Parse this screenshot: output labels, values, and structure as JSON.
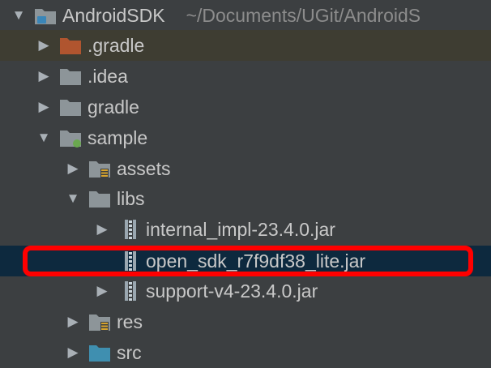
{
  "tree": {
    "root": {
      "label": "AndroidSDK",
      "path": "~/Documents/UGit/AndroidS"
    },
    "items": [
      {
        "label": ".gradle"
      },
      {
        "label": ".idea"
      },
      {
        "label": "gradle"
      },
      {
        "label": "sample"
      },
      {
        "label": "assets"
      },
      {
        "label": "libs"
      },
      {
        "label": "internal_impl-23.4.0.jar"
      },
      {
        "label": "open_sdk_r7f9df38_lite.jar"
      },
      {
        "label": "support-v4-23.4.0.jar"
      },
      {
        "label": "res"
      },
      {
        "label": "src"
      }
    ]
  },
  "colors": {
    "background": "#3c3f41",
    "folder": "#8d9599",
    "gradle_folder": "#b0552f",
    "src_folder": "#3f8fb0",
    "selection": "#0d293e",
    "highlight_border": "#ff0000"
  },
  "icons": {
    "collapsed": "chevron-right-icon",
    "expanded": "chevron-down-icon",
    "module": "module-folder-icon",
    "folder": "folder-icon",
    "resource_folder": "resource-folder-icon",
    "jar": "jar-file-icon"
  }
}
